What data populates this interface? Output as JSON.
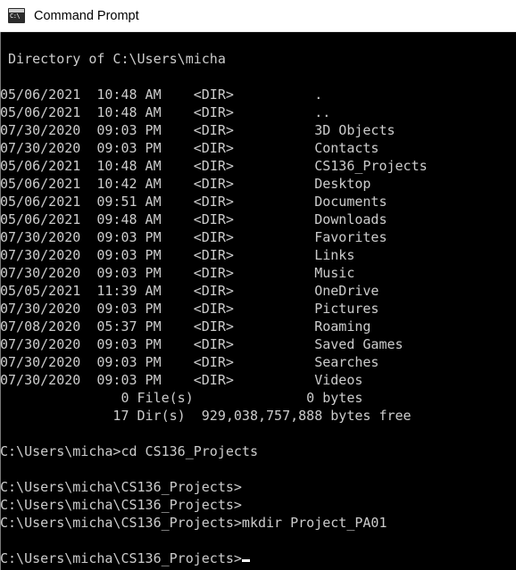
{
  "window": {
    "title": "Command Prompt",
    "icon": "command-prompt-icon",
    "icon_glyph": "C:\\",
    "title_bar_bg": "#ffffff",
    "title_text_color": "#000000",
    "console_bg": "#000000",
    "console_text_color": "#cccccc"
  },
  "console": {
    "lines": [
      "",
      " Directory of C:\\Users\\micha",
      "",
      "05/06/2021  10:48 AM    <DIR>          .",
      "05/06/2021  10:48 AM    <DIR>          ..",
      "07/30/2020  09:03 PM    <DIR>          3D Objects",
      "07/30/2020  09:03 PM    <DIR>          Contacts",
      "05/06/2021  10:48 AM    <DIR>          CS136_Projects",
      "05/06/2021  10:42 AM    <DIR>          Desktop",
      "05/06/2021  09:51 AM    <DIR>          Documents",
      "05/06/2021  09:48 AM    <DIR>          Downloads",
      "07/30/2020  09:03 PM    <DIR>          Favorites",
      "07/30/2020  09:03 PM    <DIR>          Links",
      "07/30/2020  09:03 PM    <DIR>          Music",
      "05/05/2021  11:39 AM    <DIR>          OneDrive",
      "07/30/2020  09:03 PM    <DIR>          Pictures",
      "07/08/2020  05:37 PM    <DIR>          Roaming",
      "07/30/2020  09:03 PM    <DIR>          Saved Games",
      "07/30/2020  09:03 PM    <DIR>          Searches",
      "07/30/2020  09:03 PM    <DIR>          Videos",
      "               0 File(s)              0 bytes",
      "              17 Dir(s)  929,038,757,888 bytes free",
      "",
      "C:\\Users\\micha>cd CS136_Projects",
      "",
      "C:\\Users\\micha\\CS136_Projects>",
      "C:\\Users\\micha\\CS136_Projects>",
      "C:\\Users\\micha\\CS136_Projects>mkdir Project_PA01",
      "",
      "C:\\Users\\micha\\CS136_Projects>"
    ],
    "directory_header": " Directory of C:\\Users\\micha",
    "entries": [
      {
        "date": "05/06/2021",
        "time": "10:48 AM",
        "type": "<DIR>",
        "name": "."
      },
      {
        "date": "05/06/2021",
        "time": "10:48 AM",
        "type": "<DIR>",
        "name": ".."
      },
      {
        "date": "07/30/2020",
        "time": "09:03 PM",
        "type": "<DIR>",
        "name": "3D Objects"
      },
      {
        "date": "07/30/2020",
        "time": "09:03 PM",
        "type": "<DIR>",
        "name": "Contacts"
      },
      {
        "date": "05/06/2021",
        "time": "10:48 AM",
        "type": "<DIR>",
        "name": "CS136_Projects"
      },
      {
        "date": "05/06/2021",
        "time": "10:42 AM",
        "type": "<DIR>",
        "name": "Desktop"
      },
      {
        "date": "05/06/2021",
        "time": "09:51 AM",
        "type": "<DIR>",
        "name": "Documents"
      },
      {
        "date": "05/06/2021",
        "time": "09:48 AM",
        "type": "<DIR>",
        "name": "Downloads"
      },
      {
        "date": "07/30/2020",
        "time": "09:03 PM",
        "type": "<DIR>",
        "name": "Favorites"
      },
      {
        "date": "07/30/2020",
        "time": "09:03 PM",
        "type": "<DIR>",
        "name": "Links"
      },
      {
        "date": "07/30/2020",
        "time": "09:03 PM",
        "type": "<DIR>",
        "name": "Music"
      },
      {
        "date": "05/05/2021",
        "time": "11:39 AM",
        "type": "<DIR>",
        "name": "OneDrive"
      },
      {
        "date": "07/30/2020",
        "time": "09:03 PM",
        "type": "<DIR>",
        "name": "Pictures"
      },
      {
        "date": "07/08/2020",
        "time": "05:37 PM",
        "type": "<DIR>",
        "name": "Roaming"
      },
      {
        "date": "07/30/2020",
        "time": "09:03 PM",
        "type": "<DIR>",
        "name": "Saved Games"
      },
      {
        "date": "07/30/2020",
        "time": "09:03 PM",
        "type": "<DIR>",
        "name": "Searches"
      },
      {
        "date": "07/30/2020",
        "time": "09:03 PM",
        "type": "<DIR>",
        "name": "Videos"
      }
    ],
    "summary": {
      "file_count": "0",
      "file_label": "File(s)",
      "file_bytes": "0 bytes",
      "dir_count": "17",
      "dir_label": "Dir(s)",
      "free_bytes": "929,038,757,888 bytes free"
    },
    "commands": [
      {
        "prompt": "C:\\Users\\micha>",
        "command": "cd CS136_Projects"
      },
      {
        "prompt": "C:\\Users\\micha\\CS136_Projects>",
        "command": ""
      },
      {
        "prompt": "C:\\Users\\micha\\CS136_Projects>",
        "command": ""
      },
      {
        "prompt": "C:\\Users\\micha\\CS136_Projects>",
        "command": "mkdir Project_PA01"
      },
      {
        "prompt": "C:\\Users\\micha\\CS136_Projects>",
        "command": ""
      }
    ],
    "final_prompt": "C:\\Users\\micha\\CS136_Projects>"
  }
}
